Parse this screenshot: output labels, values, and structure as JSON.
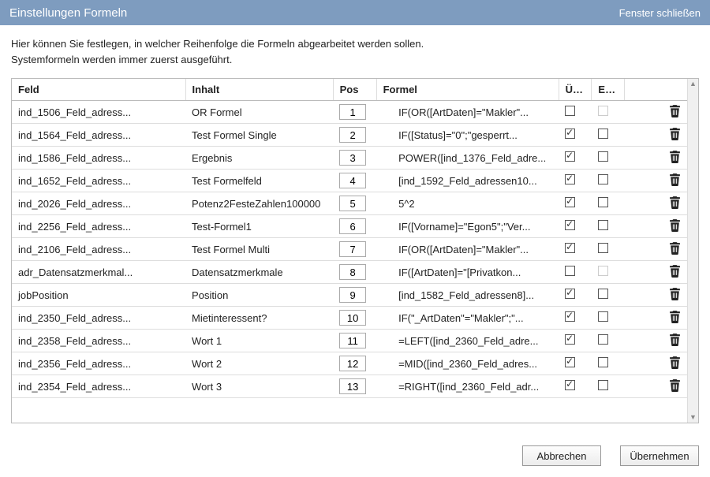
{
  "titlebar": {
    "title": "Einstellungen Formeln",
    "close": "Fenster schließen"
  },
  "description": {
    "line1": "Hier können Sie festlegen, in welcher Reihenfolge die Formeln abgearbeitet werden sollen.",
    "line2": "Systemformeln werden immer zuerst ausgeführt."
  },
  "columns": {
    "feld": "Feld",
    "inhalt": "Inhalt",
    "pos": "Pos",
    "formel": "Formel",
    "ueber": "Übe...",
    "edit": "Edit..."
  },
  "rows": [
    {
      "feld": "ind_1506_Feld_adress...",
      "inhalt": "OR Formel",
      "pos": "1",
      "formel": "IF(OR([ArtDaten]=\"Makler\"...",
      "ueber": false,
      "edit": false,
      "edit_disabled": true
    },
    {
      "feld": "ind_1564_Feld_adress...",
      "inhalt": "Test Formel Single",
      "pos": "2",
      "formel": "IF([Status]=\"0\";\"gesperrt...",
      "ueber": true,
      "edit": false,
      "edit_disabled": false
    },
    {
      "feld": "ind_1586_Feld_adress...",
      "inhalt": "Ergebnis",
      "pos": "3",
      "formel": "POWER([ind_1376_Feld_adre...",
      "ueber": true,
      "edit": false,
      "edit_disabled": false
    },
    {
      "feld": "ind_1652_Feld_adress...",
      "inhalt": "Test Formelfeld",
      "pos": "4",
      "formel": "[ind_1592_Feld_adressen10...",
      "ueber": true,
      "edit": false,
      "edit_disabled": false
    },
    {
      "feld": "ind_2026_Feld_adress...",
      "inhalt": "Potenz2FesteZahlen100000",
      "pos": "5",
      "formel": "5^2",
      "ueber": true,
      "edit": false,
      "edit_disabled": false
    },
    {
      "feld": "ind_2256_Feld_adress...",
      "inhalt": "Test-Formel1",
      "pos": "6",
      "formel": "IF([Vorname]=\"Egon5\";\"Ver...",
      "ueber": true,
      "edit": false,
      "edit_disabled": false
    },
    {
      "feld": "ind_2106_Feld_adress...",
      "inhalt": "Test Formel Multi",
      "pos": "7",
      "formel": "IF(OR([ArtDaten]=\"Makler\"...",
      "ueber": true,
      "edit": false,
      "edit_disabled": false
    },
    {
      "feld": "adr_Datensatzmerkmal...",
      "inhalt": "Datensatzmerkmale",
      "pos": "8",
      "formel": "IF([ArtDaten]=\"[Privatkon...",
      "ueber": false,
      "edit": false,
      "edit_disabled": true
    },
    {
      "feld": "jobPosition",
      "inhalt": "Position",
      "pos": "9",
      "formel": "[ind_1582_Feld_adressen8]...",
      "ueber": true,
      "edit": false,
      "edit_disabled": false
    },
    {
      "feld": "ind_2350_Feld_adress...",
      "inhalt": "Mietinteressent?",
      "pos": "10",
      "formel": "IF(\"_ArtDaten\"=\"Makler\";\"...",
      "ueber": true,
      "edit": false,
      "edit_disabled": false
    },
    {
      "feld": "ind_2358_Feld_adress...",
      "inhalt": "Wort 1",
      "pos": "11",
      "formel": "=LEFT([ind_2360_Feld_adre...",
      "ueber": true,
      "edit": false,
      "edit_disabled": false
    },
    {
      "feld": "ind_2356_Feld_adress...",
      "inhalt": "Wort 2",
      "pos": "12",
      "formel": "=MID([ind_2360_Feld_adres...",
      "ueber": true,
      "edit": false,
      "edit_disabled": false
    },
    {
      "feld": "ind_2354_Feld_adress...",
      "inhalt": "Wort 3",
      "pos": "13",
      "formel": "=RIGHT([ind_2360_Feld_adr...",
      "ueber": true,
      "edit": false,
      "edit_disabled": false
    }
  ],
  "footer": {
    "cancel": "Abbrechen",
    "apply": "Übernehmen"
  }
}
